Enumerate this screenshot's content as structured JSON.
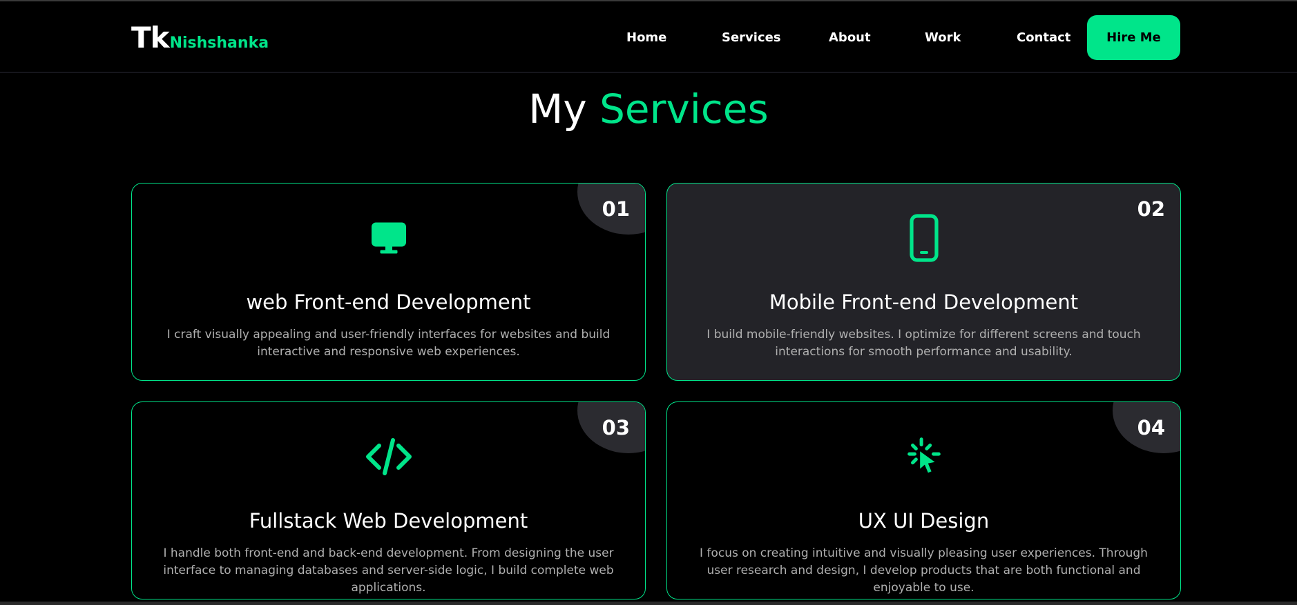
{
  "brand": {
    "tk": "Tk",
    "name": "Nishshanka"
  },
  "nav": {
    "items": [
      {
        "label": "Home"
      },
      {
        "label": "Services"
      },
      {
        "label": "About"
      },
      {
        "label": "Work"
      },
      {
        "label": "Contact"
      }
    ],
    "cta_label": "Hire Me"
  },
  "section": {
    "title_prefix": "My",
    "title_accent": "Services"
  },
  "services": [
    {
      "number": "01",
      "icon": "monitor-icon",
      "title": "web Front-end Development",
      "description": "I craft visually appealing and user-friendly interfaces for websites and build interactive and responsive web experiences."
    },
    {
      "number": "02",
      "icon": "smartphone-icon",
      "title": "Mobile Front-end Development",
      "description": "I build mobile-friendly websites. I optimize for different screens and touch interactions for smooth performance and usability."
    },
    {
      "number": "03",
      "icon": "code-icon",
      "title": "Fullstack Web Development",
      "description": "I handle both front-end and back-end development. From designing the user interface to managing databases and server-side logic, I build complete web applications."
    },
    {
      "number": "04",
      "icon": "cursor-click-icon",
      "title": "UX UI Design",
      "description": "I focus on creating intuitive and visually pleasing user experiences. Through user research and design, I develop products that are both functional and enjoyable to use."
    }
  ],
  "colors": {
    "accent": "#00e58a",
    "background": "#000000",
    "card_highlight": "#232328"
  }
}
